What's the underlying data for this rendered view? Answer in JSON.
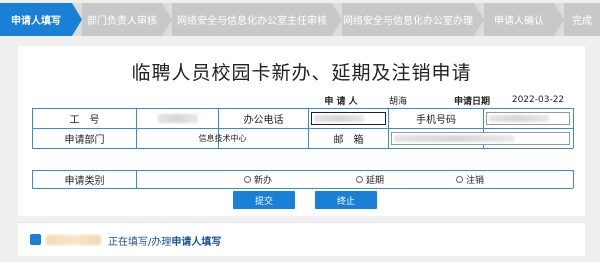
{
  "steps": [
    {
      "label": "申请人填写"
    },
    {
      "label": "部门负责人审核"
    },
    {
      "label": "网络安全与信息化办公室主任审核"
    },
    {
      "label": "网络安全与信息化办公室办理"
    },
    {
      "label": "申请人确认"
    },
    {
      "label": "完成"
    }
  ],
  "form": {
    "title": "临聘人员校园卡新办、延期及注销申请",
    "applicant_label": "申 请 人",
    "applicant_value": "胡海",
    "date_label": "申请日期",
    "date_value": "2022-03-22",
    "emp_no_label": "工　号",
    "office_phone_label": "办公电话",
    "mobile_label": "手机号码",
    "dept_label": "申请部门",
    "dept_value": "信息技术中心",
    "email_label": "邮　箱",
    "type_label": "申请类别",
    "options": [
      "新办",
      "延期",
      "注销"
    ],
    "submit_label": "提交",
    "terminate_label": "终止"
  },
  "status": {
    "prefix": "正在填写/办理",
    "step": "申请人填写"
  },
  "colors": {
    "accent": "#1a7fd6",
    "step_inactive": "#c8c8c8",
    "table_line": "#3c8ad0"
  }
}
